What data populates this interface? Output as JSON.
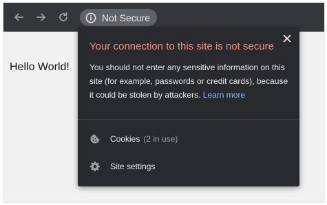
{
  "browser": {
    "security_chip_label": "Not Secure"
  },
  "page": {
    "content_text": "Hello World!"
  },
  "site_info_popup": {
    "title": "Your connection to this site is not secure",
    "warning_text": "You should not enter any sensitive information on this site (for example, passwords or credit cards), because it could be stolen by attackers.",
    "learn_more_label": "Learn more",
    "cookies_label": "Cookies",
    "cookies_count": "(2 in use)",
    "site_settings_label": "Site settings"
  },
  "colors": {
    "toolbar_bg": "#35363a",
    "popup_bg": "#292a2d",
    "warning_title": "#f28b82",
    "link": "#8ab4f8"
  },
  "icons": [
    "back-arrow-icon",
    "forward-arrow-icon",
    "reload-icon",
    "info-icon",
    "close-icon",
    "cookie-icon",
    "gear-icon"
  ]
}
